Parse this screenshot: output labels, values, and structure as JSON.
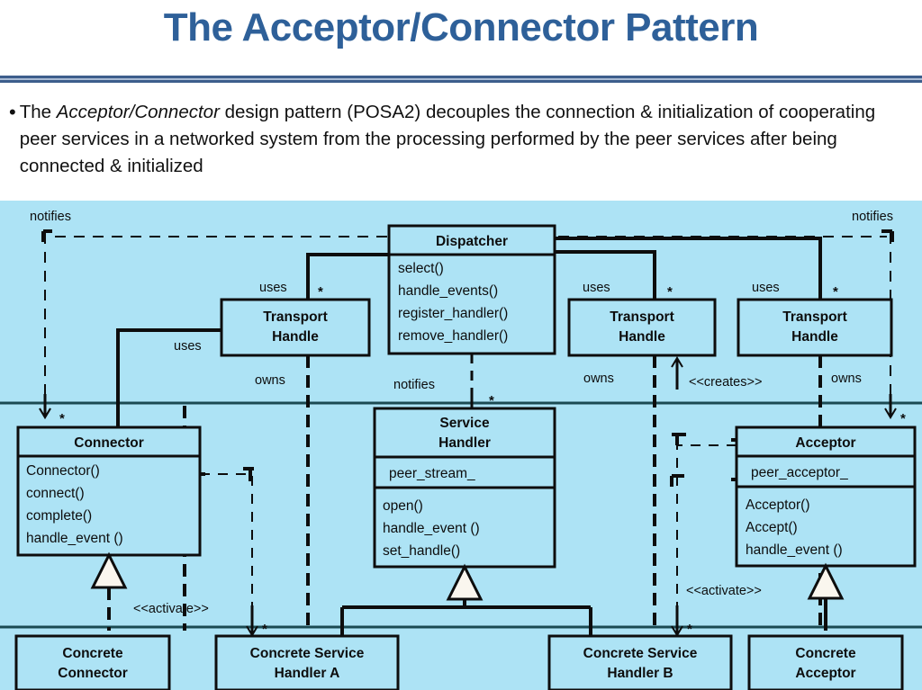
{
  "slide": {
    "title": "The Acceptor/Connector Pattern",
    "title_color": "#2E6099",
    "background_color": "#FFFFFF",
    "diagram_background_color": "#ADE3F5",
    "line_color": "#0D0D0D"
  },
  "bullet": {
    "marker": "•",
    "part1": "The ",
    "emphasis": "Acceptor/Connector",
    "part2": " design pattern (POSA2) decouples the connection & initialization of cooperating peer services in a networked system from the processing performed by the peer services after being connected & initialized"
  },
  "diagram": {
    "classes": {
      "dispatcher": {
        "name": "Dispatcher",
        "attributes": [],
        "operations": [
          "select()",
          "handle_events()",
          "register_handler()",
          "remove_handler()"
        ]
      },
      "transport_handle_left": {
        "name_line1": "Transport",
        "name_line2": "Handle"
      },
      "transport_handle_mid": {
        "name_line1": "Transport",
        "name_line2": "Handle"
      },
      "transport_handle_right": {
        "name_line1": "Transport",
        "name_line2": "Handle"
      },
      "connector": {
        "name": "Connector",
        "attributes": [],
        "operations": [
          "Connector()",
          "connect()",
          "complete()",
          "handle_event ()"
        ]
      },
      "service_handler": {
        "name_line1": "Service",
        "name_line2": "Handler",
        "attributes": [
          "peer_stream_"
        ],
        "operations": [
          "open()",
          "handle_event ()",
          "set_handle()"
        ]
      },
      "acceptor": {
        "name": "Acceptor",
        "attributes": [
          "peer_acceptor_"
        ],
        "operations": [
          "Acceptor()",
          "Accept()",
          "handle_event ()"
        ]
      },
      "concrete_connector": {
        "line1": "Concrete",
        "line2": "Connector"
      },
      "concrete_service_handler_a": {
        "line1": "Concrete Service",
        "line2": "Handler A"
      },
      "concrete_service_handler_b": {
        "line1": "Concrete Service",
        "line2": "Handler B"
      },
      "concrete_acceptor": {
        "line1": "Concrete",
        "line2": "Acceptor"
      }
    },
    "edge_labels": {
      "notifies_left": "notifies",
      "notifies_right": "notifies",
      "notifies_center": "notifies",
      "uses_th_left_top": "uses",
      "uses_connector": "uses",
      "uses_th_mid": "uses",
      "uses_th_right": "uses",
      "owns_left": "owns",
      "owns_mid": "owns",
      "owns_right": "owns",
      "creates": "<<creates>>",
      "activate_left": "<<activate>>",
      "activate_right": "<<activate>>"
    },
    "multiplicities": {
      "m1": "*",
      "m2": "*",
      "m3": "*",
      "m4": "*",
      "m5": "*",
      "m6": "*",
      "m7": "*",
      "m8": "*"
    }
  }
}
